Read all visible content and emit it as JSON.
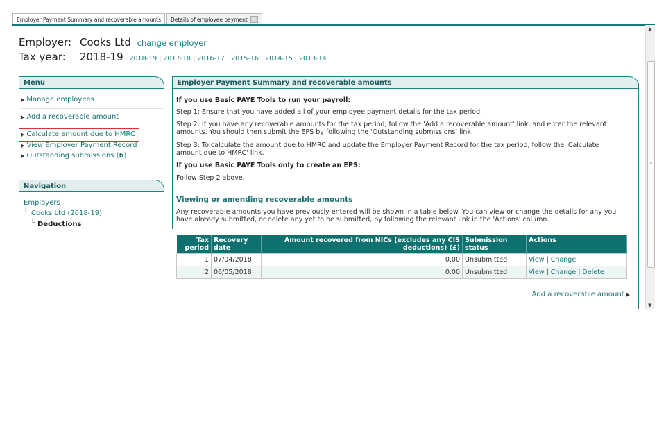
{
  "tabs": [
    {
      "label": "Employer Payment Summary and recoverable amounts"
    },
    {
      "label": "Details of employee payment"
    }
  ],
  "employer": {
    "label": "Employer:",
    "name": "Cooks Ltd",
    "change_link": "change employer"
  },
  "tax_year": {
    "label": "Tax year:",
    "current": "2018-19",
    "years": [
      "2018-19",
      "2017-18",
      "2016-17",
      "2015-16",
      "2014-15",
      "2013-14"
    ]
  },
  "menu": {
    "title": "Menu",
    "items": [
      {
        "label": "Manage employees"
      },
      {
        "label": "Add a recoverable amount"
      },
      {
        "label": "Calculate amount due to HMRC"
      },
      {
        "label": "View Employer Payment Record"
      },
      {
        "label": "Outstanding submissions (",
        "count": "6",
        "suffix": ")"
      }
    ]
  },
  "navigation": {
    "title": "Navigation",
    "root": "Employers",
    "employer": "Cooks Ltd (2018-19)",
    "current": "Deductions"
  },
  "main": {
    "title": "Employer Payment Summary and recoverable amounts",
    "h1": "If you use Basic PAYE Tools to run your payroll:",
    "step1": "Step 1: Ensure that you have added all of your employee payment details for the tax period.",
    "step2a": "Step 2: If you have any recoverable amounts for the tax period, follow the 'Add a recoverable amount' link, and enter the relevant",
    "step2b": "amounts. You should then submit the EPS by following the 'Outstanding submissions' link.",
    "step3a": "Step 3: To calculate the amount due to HMRC and update the Employer Payment Record for the tax period, follow the 'Calculate",
    "step3b": "amount due to HMRC' link.",
    "h2": "If you use Basic PAYE Tools only to create an EPS:",
    "follow": "Follow Step 2 above.",
    "sub_title": "Viewing or amending recoverable amounts",
    "sub_text_a": "Any recoverable amounts you have previously entered will be shown in a table below. You can view or change the details for any you",
    "sub_text_b": "have already submitted, or delete any yet to be submitted, by following the relevant link in the 'Actions' column.",
    "table": {
      "headers": [
        "Tax period",
        "Recovery date",
        "Amount recovered from NICs (excludes any CIS deductions) (£)",
        "Submission status",
        "Actions"
      ],
      "rows": [
        {
          "period": "1",
          "date": "07/04/2018",
          "amount": "0.00",
          "status": "Unsubmitted",
          "actions": [
            "View",
            "Change"
          ]
        },
        {
          "period": "2",
          "date": "06/05/2018",
          "amount": "0.00",
          "status": "Unsubmitted",
          "actions": [
            "View",
            "Change",
            "Delete"
          ]
        }
      ]
    },
    "add_link": "Add a recoverable amount"
  },
  "colors": {
    "accent": "#0f7070",
    "highlight_box": "#d93333",
    "link": "#1a7575"
  }
}
